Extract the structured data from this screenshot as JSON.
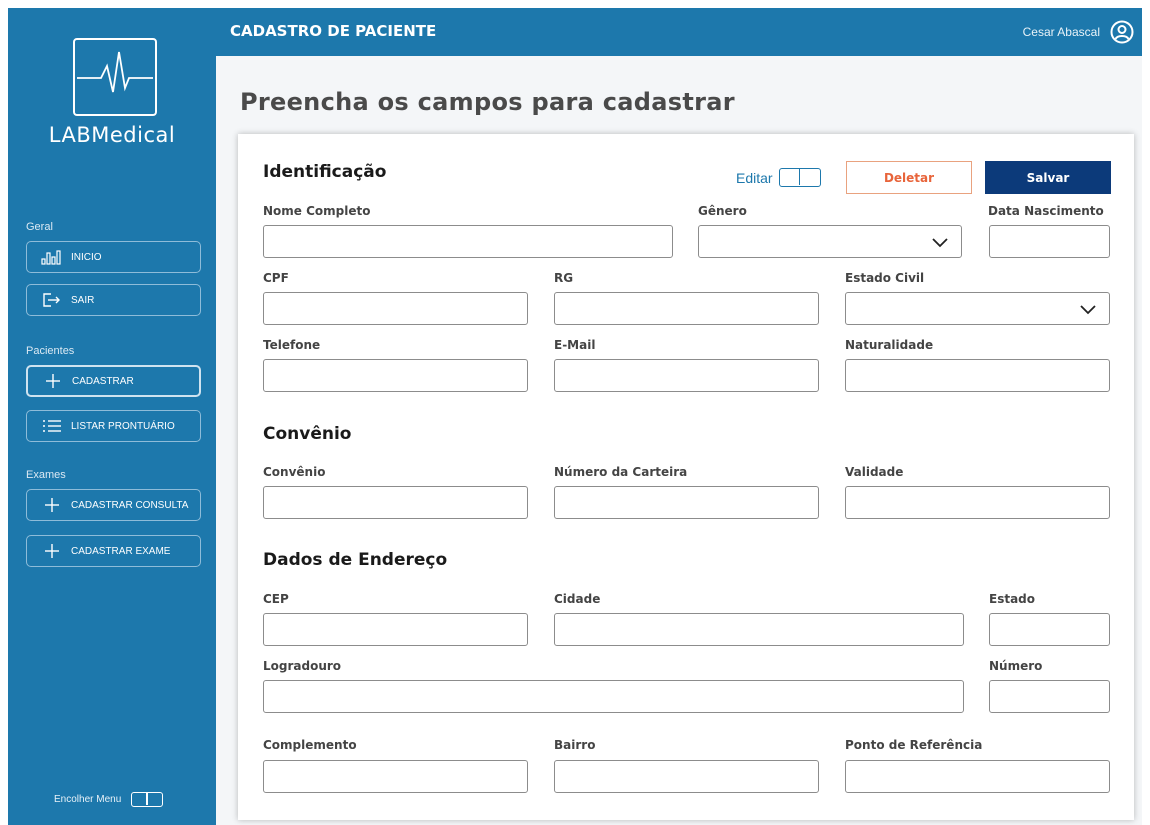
{
  "brand": {
    "name": "LABMedical"
  },
  "header": {
    "title": "CADASTRO DE PACIENTE",
    "user_name": "Cesar Abascal"
  },
  "sidebar": {
    "sections": [
      {
        "label": "Geral",
        "items": [
          {
            "label": "INICIO",
            "icon": "bar-chart-icon"
          },
          {
            "label": "SAIR",
            "icon": "logout-icon"
          }
        ]
      },
      {
        "label": "Pacientes",
        "items": [
          {
            "label": "CADASTRAR",
            "icon": "plus-icon",
            "active": true
          },
          {
            "label": "LISTAR PRONTUÁRIO",
            "icon": "list-icon"
          }
        ]
      },
      {
        "label": "Exames",
        "items": [
          {
            "label": "CADASTRAR CONSULTA",
            "icon": "plus-icon"
          },
          {
            "label": "CADASTRAR EXAME",
            "icon": "plus-icon"
          }
        ]
      }
    ],
    "collapse_label": "Encolher Menu"
  },
  "page": {
    "title": "Preencha os campos para cadastrar"
  },
  "form": {
    "identificacao": {
      "title": "Identificação",
      "edit_label": "Editar",
      "delete_label": "Deletar",
      "save_label": "Salvar",
      "fields": {
        "nome": "Nome Completo",
        "genero": "Gênero",
        "nascimento": "Data Nascimento",
        "cpf": "CPF",
        "rg": "RG",
        "estado_civil": "Estado Civil",
        "telefone": "Telefone",
        "email": "E-Mail",
        "naturalidade": "Naturalidade"
      }
    },
    "convenio": {
      "title": "Convênio",
      "fields": {
        "convenio": "Convênio",
        "carteira": "Número da Carteira",
        "validade": "Validade"
      }
    },
    "endereco": {
      "title": "Dados de Endereço",
      "fields": {
        "cep": "CEP",
        "cidade": "Cidade",
        "estado": "Estado",
        "logradouro": "Logradouro",
        "numero": "Número",
        "complemento": "Complemento",
        "bairro": "Bairro",
        "referencia": "Ponto de Referência"
      }
    }
  },
  "colors": {
    "primary": "#1d78ac",
    "save": "#0c3a7a",
    "delete": "#e8643a",
    "background": "#f4f6f8"
  }
}
